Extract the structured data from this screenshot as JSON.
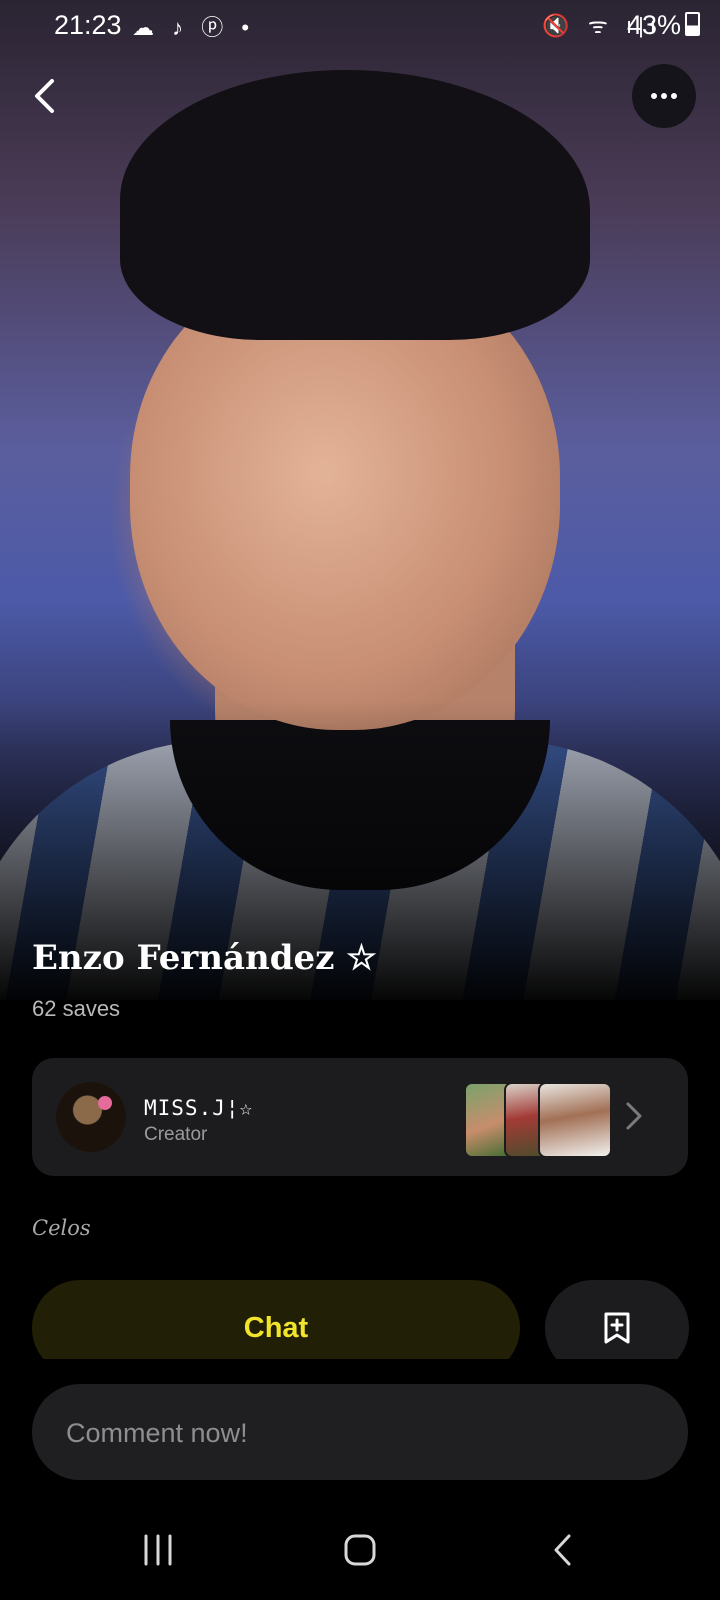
{
  "status_bar": {
    "time": "21:23",
    "notification_icons": "☁ ♪ ⓟ •",
    "right_icons": "🔇 ᯤ ı|ı",
    "battery": "43%"
  },
  "header": {
    "back_icon": "chevron-left-icon",
    "more_icon": "more-horizontal-icon"
  },
  "profile": {
    "name": "Enzo Fernández ☆",
    "saves": "62 saves"
  },
  "creator": {
    "name": "MISS.J¦☆",
    "role": "Creator"
  },
  "tag": "Celos",
  "actions": {
    "chat_label": "Chat",
    "bookmark_icon": "bookmark-add-icon"
  },
  "comment": {
    "placeholder": "Comment now!"
  },
  "colors": {
    "accent": "#f0e52c",
    "chat_bg": "#211f05",
    "card_bg": "#1c1c1e"
  }
}
